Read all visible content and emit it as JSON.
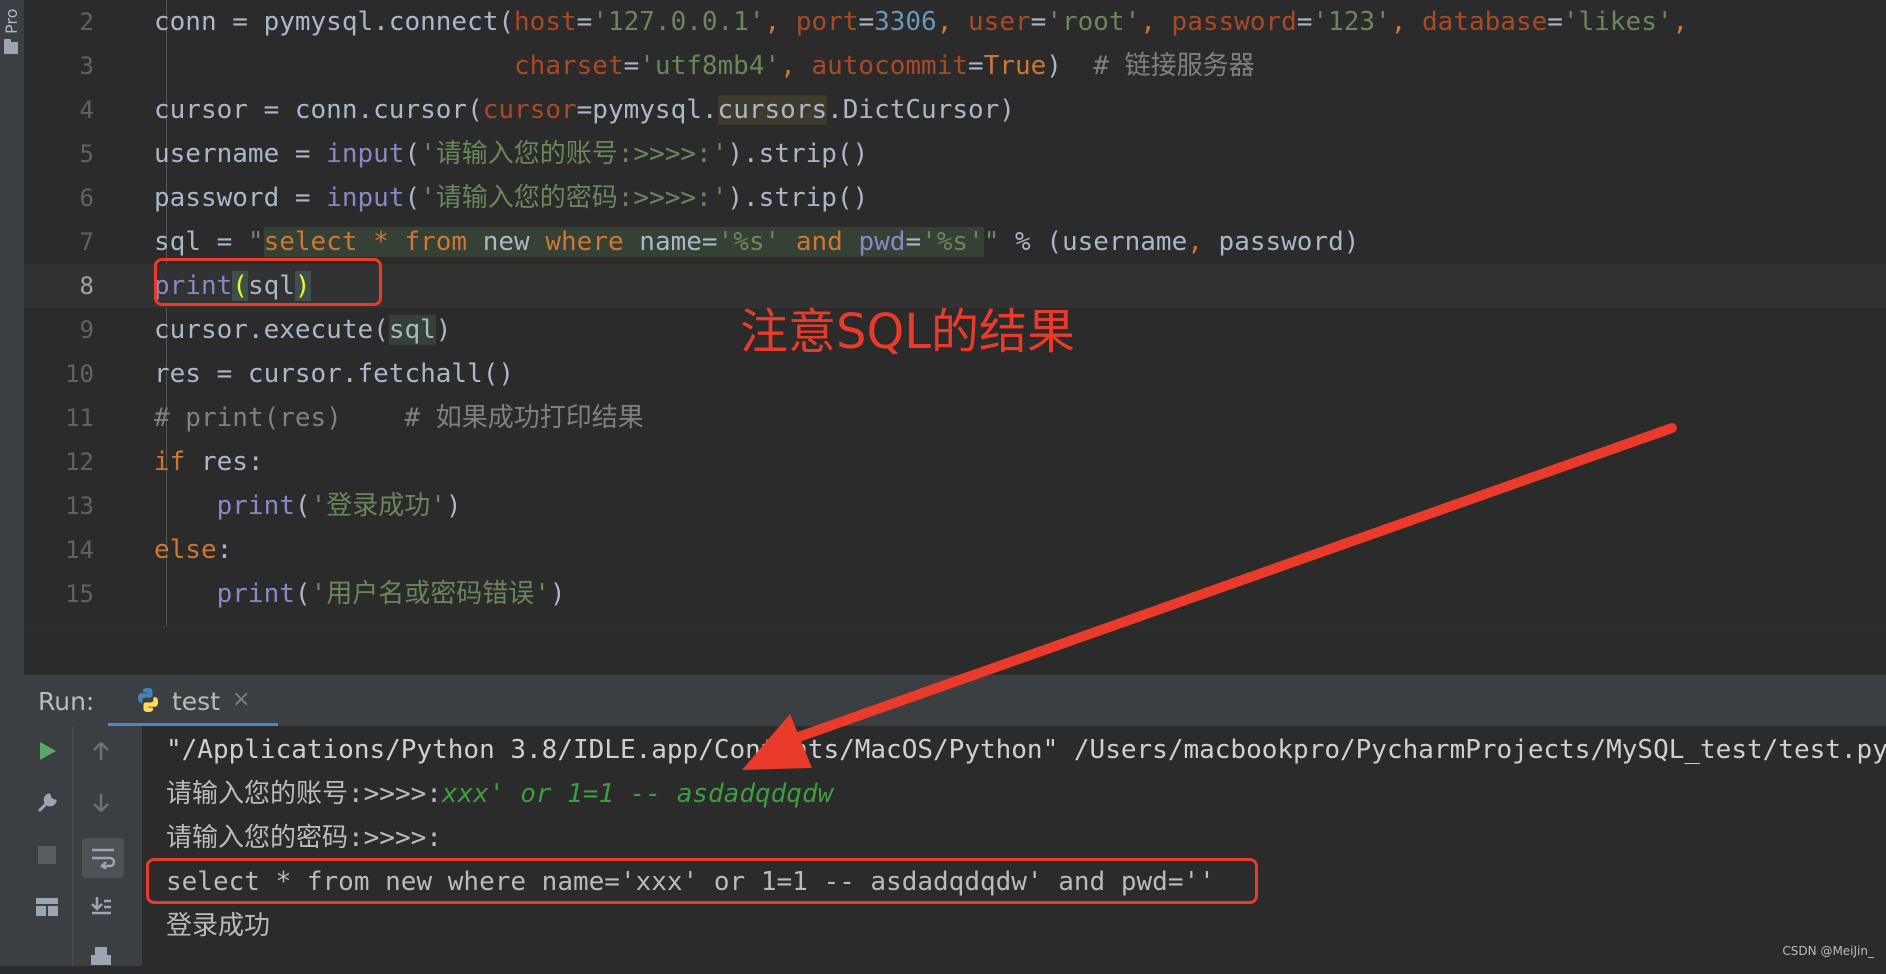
{
  "sidebar": {
    "project_label": "Pro",
    "folder_icon": "folder-icon"
  },
  "editor": {
    "current_line": 8,
    "lines": [
      {
        "num": "2"
      },
      {
        "num": "3"
      },
      {
        "num": "4"
      },
      {
        "num": "5"
      },
      {
        "num": "6"
      },
      {
        "num": "7"
      },
      {
        "num": "8"
      },
      {
        "num": "9"
      },
      {
        "num": "10"
      },
      {
        "num": "11"
      },
      {
        "num": "12"
      },
      {
        "num": "13"
      },
      {
        "num": "14"
      },
      {
        "num": "15"
      }
    ],
    "l2": {
      "a": "conn = pymysql.connect(",
      "kw1": "host",
      "eq1": "=",
      "s1": "'127.0.0.1'",
      "c1": ", ",
      "kw2": "port",
      "eq2": "=",
      "n1": "3306",
      "c2": ", ",
      "kw3": "user",
      "eq3": "=",
      "s2": "'root'",
      "c3": ", ",
      "kw4": "password",
      "eq4": "=",
      "s3": "'123'",
      "c4": ", ",
      "kw5": "database",
      "eq5": "=",
      "s4": "'likes'",
      "c5": ","
    },
    "l3": {
      "indent": "                       ",
      "kw1": "charset",
      "eq1": "=",
      "s1": "'utf8mb4'",
      "c1": ", ",
      "kw2": "autocommit",
      "eq2": "=",
      "t1": "True",
      "c2": ")  ",
      "cm": "# 链接服务器"
    },
    "l4": {
      "a": "cursor = conn.cursor(",
      "kw1": "cursor",
      "eq1": "=pymysql.",
      "hl1": "cursors",
      "b": ".DictCursor)"
    },
    "l5": {
      "a": "username = ",
      "fn": "input",
      "b": "(",
      "s1": "'请输入您的账号:>>>>:'",
      "c": ").strip()"
    },
    "l6": {
      "a": "password = ",
      "fn": "input",
      "b": "(",
      "s1": "'请输入您的密码:>>>>:'",
      "c": ").strip()"
    },
    "l7": {
      "a": "sql = ",
      "q1": "\"",
      "sk1": "select",
      "w1": " ",
      "op1": "*",
      "w2": " ",
      "sk2": "from",
      "w3": " new ",
      "sk3": "where",
      "w4": " name=",
      "sq1": "'%s'",
      "w5": " ",
      "sk4": "and",
      "w6": " ",
      "sp1": "pwd",
      "w7": "=",
      "sq2": "'%s'",
      "q2": "\"",
      "b": " % (username",
      "k1": ",",
      "c": " password)"
    },
    "l8": {
      "fn": "print",
      "br1": "(",
      "a": "sql",
      "br2": ")"
    },
    "l9": {
      "a": "cursor.execute(",
      "hl": "sql",
      "b": ")"
    },
    "l10": {
      "a": "res = cursor.fetchall()"
    },
    "l11": {
      "cm": "# print(res)    # 如果成功打印结果"
    },
    "l12": {
      "kw": "if",
      "a": " res:"
    },
    "l13": {
      "indent": "    ",
      "fn": "print",
      "b": "(",
      "s1": "'登录成功'",
      "c": ")"
    },
    "l14": {
      "kw": "else",
      "a": ":"
    },
    "l15": {
      "indent": "    ",
      "fn": "print",
      "b": "(",
      "s1": "'用户名或密码错误'",
      "c": ")"
    }
  },
  "annotation": {
    "text": "注意SQL的结果",
    "color": "#ea3a29"
  },
  "run_panel": {
    "label": "Run:",
    "tab": {
      "label": "test",
      "icon": "python-icon",
      "close": "×"
    },
    "toolbar": [
      {
        "icon": "play-icon"
      },
      {
        "icon": "up-arrow-icon"
      },
      {
        "icon": "wrench-icon"
      },
      {
        "icon": "down-arrow-icon"
      },
      {
        "icon": "stop-icon"
      },
      {
        "icon": "soft-wrap-icon"
      },
      {
        "icon": "layout-icon"
      },
      {
        "icon": "scroll-to-end-icon"
      },
      {
        "icon": "print-icon"
      }
    ]
  },
  "console": {
    "cmd": "\"/Applications/Python 3.8/IDLE.app/Contents/MacOS/Python\" /Users/macbookpro/PycharmProjects/MySQL_test/test.py",
    "prompt1": "请输入您的账号:>>>>:",
    "input1": "xxx' or 1=1 -- asdadqdqdw",
    "prompt2": "请输入您的密码:>>>>:",
    "sql_output": "select * from new where name='xxx' or 1=1 -- asdadqdqdw' and pwd=''",
    "result": "登录成功"
  },
  "watermark": "CSDN @MeiJin_",
  "colors": {
    "keyword": "#cc7832",
    "string": "#6a8759",
    "number": "#6897bb",
    "param": "#aa4926",
    "builtin": "#8888c6",
    "comment": "#808080",
    "accent": "#4a88c7",
    "annotation": "#ea3a29"
  }
}
